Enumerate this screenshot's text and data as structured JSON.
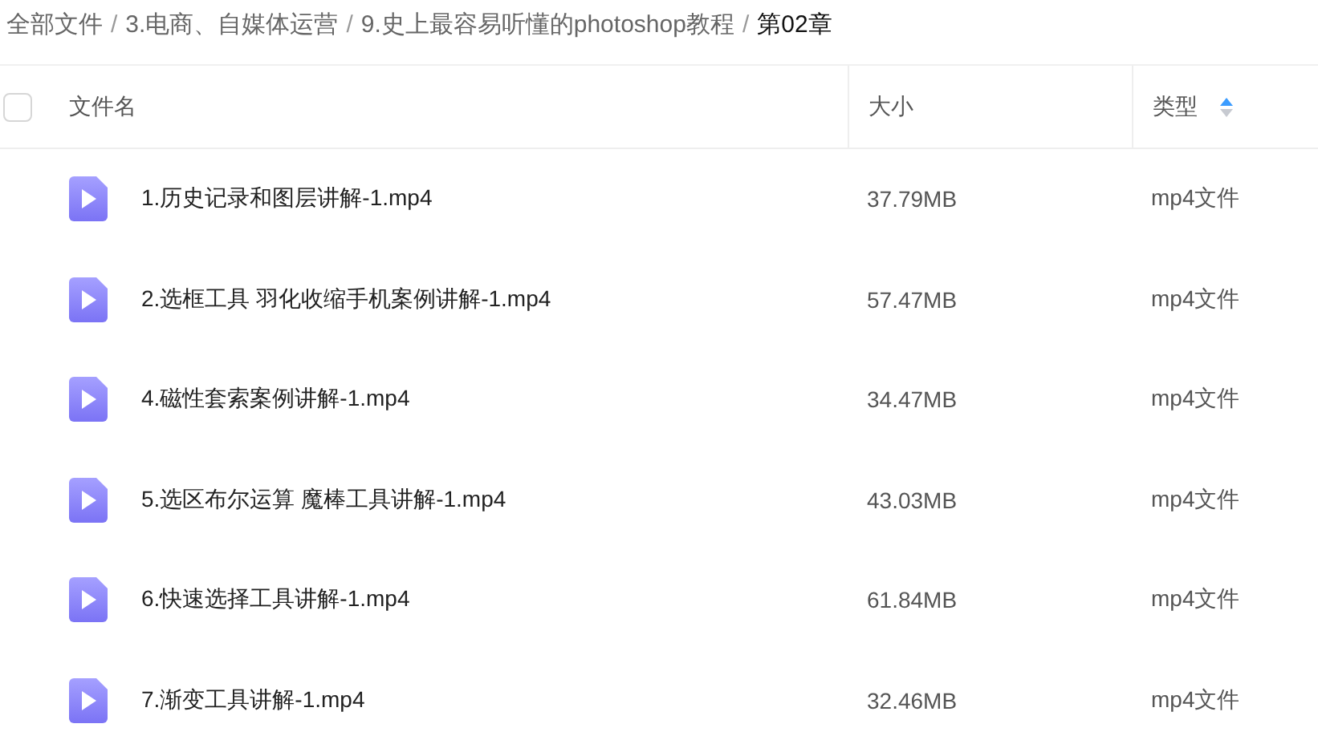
{
  "breadcrumb": [
    {
      "label": "全部文件",
      "current": false
    },
    {
      "separator": "/",
      "label": "3.电商、自媒体运营",
      "current": false
    },
    {
      "separator": "/",
      "label": "9.史上最容易听懂的photoshop教程",
      "current": false
    },
    {
      "separator": "/",
      "label": "第02章",
      "current": true
    }
  ],
  "table": {
    "select_all": {
      "checked": false
    },
    "columns": [
      {
        "label": "文件名",
        "sorted": false
      },
      {
        "label": "大小",
        "sorted": false
      },
      {
        "label": "类型",
        "sorted": true
      }
    ],
    "rows": [
      {
        "kind": "video",
        "name": "1.历史记录和图层讲解-1.mp4",
        "size": "37.79MB",
        "type": "mp4文件"
      },
      {
        "kind": "video",
        "name": "2.选框工具 羽化收缩手机案例讲解-1.mp4",
        "size": "57.47MB",
        "type": "mp4文件"
      },
      {
        "kind": "video",
        "name": "4.磁性套索案例讲解-1.mp4",
        "size": "34.47MB",
        "type": "mp4文件"
      },
      {
        "kind": "video",
        "name": "5.选区布尔运算 魔棒工具讲解-1.mp4",
        "size": "43.03MB",
        "type": "mp4文件"
      },
      {
        "kind": "video",
        "name": "6.快速选择工具讲解-1.mp4",
        "size": "61.84MB",
        "type": "mp4文件"
      },
      {
        "kind": "video",
        "name": "7.渐变工具讲解-1.mp4",
        "size": "32.46MB",
        "type": "mp4文件"
      }
    ]
  }
}
